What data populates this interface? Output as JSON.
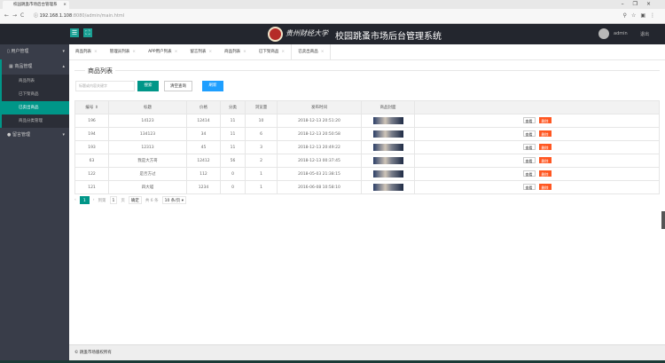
{
  "browser": {
    "tab_title": "校园跳蚤市场后台管理系",
    "url_host": "192.168.1.108",
    "url_path": ":8080/admin/main.html"
  },
  "header": {
    "logo_text": "贵州财经大学",
    "title": "校园跳蚤市场后台管理系统",
    "username": "admin",
    "logout": "退出"
  },
  "sidebar": {
    "groups": [
      {
        "label": "用户管理",
        "open": false
      },
      {
        "label": "商品管理",
        "open": true,
        "items": [
          "商品列表",
          "已下架商品",
          "已卖出商品",
          "商品分类管理"
        ],
        "active": "已卖出商品"
      },
      {
        "label": "留言管理",
        "open": false
      }
    ]
  },
  "tabs": [
    "商品列表",
    "管理员列表",
    "APP用户列表",
    "留言列表",
    "商品列表",
    "已下架商品",
    "已卖出商品"
  ],
  "main": {
    "section_title": "商品列表",
    "search_placeholder": "标题或内容关键字",
    "search_btn": "搜索",
    "clear_btn": "清空查询",
    "refresh_btn": "刷新"
  },
  "table": {
    "headers": [
      "编号 ⇕",
      "标题",
      "价格",
      "分类",
      "浏览量",
      "发布时间",
      "商品封面",
      ""
    ],
    "rows": [
      [
        "196",
        "14123",
        "12414",
        "11",
        "10",
        "2018-12-13 20:51:20"
      ],
      [
        "194",
        "134123",
        "34",
        "11",
        "6",
        "2018-12-13 20:50:58"
      ],
      [
        "193",
        "12313",
        "45",
        "11",
        "3",
        "2018-12-13 20:49:22"
      ],
      [
        "63",
        "我是大方哥",
        "12412",
        "56",
        "2",
        "2018-12-13 00:37:45"
      ],
      [
        "122",
        "是否方过",
        "112",
        "0",
        "1",
        "2018-05-03 21:38:15"
      ],
      [
        "121",
        "四大喵",
        "1234",
        "0",
        "1",
        "2016-06-08 10:58:10"
      ]
    ],
    "view": "查看",
    "delete": "删除"
  },
  "pager": {
    "prev": "‹",
    "page": "1",
    "next": "›",
    "goto": "到第",
    "input": "1",
    "page_unit": "页",
    "confirm": "确定",
    "total": "共 6 条",
    "per_page": "10 条/页 ▾"
  },
  "footer": "© 跳蚤市场版权所有"
}
